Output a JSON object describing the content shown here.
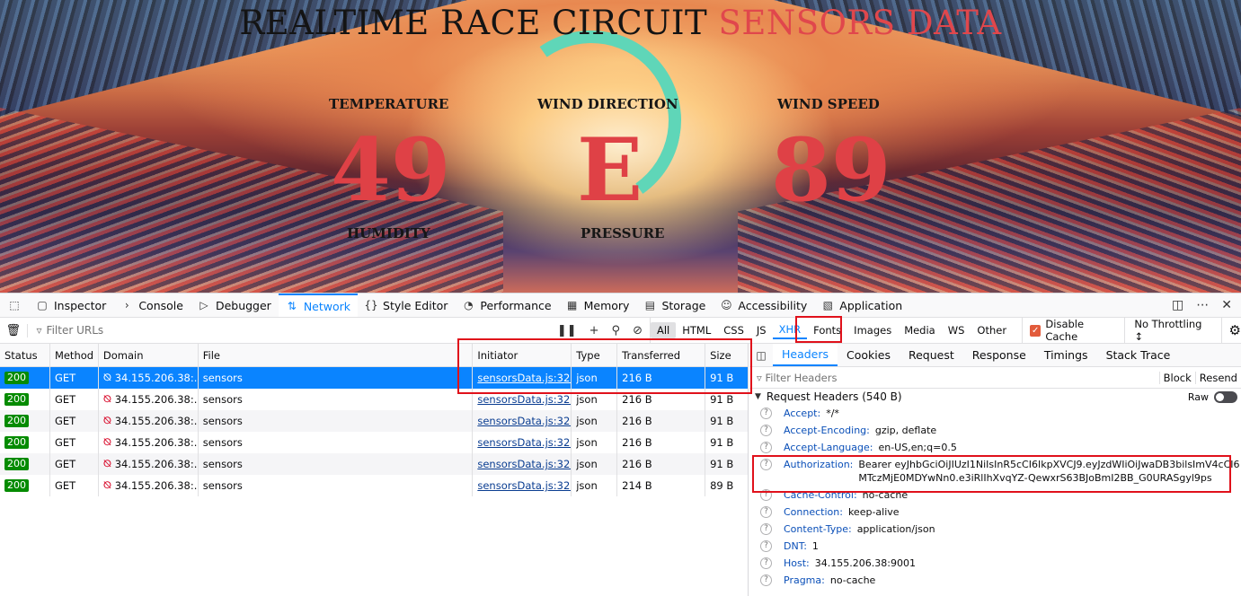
{
  "page": {
    "title_main": "REALTIME RACE CIRCUIT ",
    "title_accent": "SENSORS DATA",
    "metrics": [
      {
        "label": "TEMPERATURE",
        "value": "49"
      },
      {
        "label": "WIND DIRECTION",
        "value": "E"
      },
      {
        "label": "WIND SPEED",
        "value": "89"
      }
    ],
    "labels_row2": [
      "HUMIDITY",
      "PRESSURE"
    ]
  },
  "devtools": {
    "tabs": [
      "Inspector",
      "Console",
      "Debugger",
      "Network",
      "Style Editor",
      "Performance",
      "Memory",
      "Storage",
      "Accessibility",
      "Application"
    ],
    "active_tab": "Network",
    "filter_placeholder": "Filter URLs",
    "filter_types": [
      "All",
      "HTML",
      "CSS",
      "JS",
      "XHR",
      "Fonts",
      "Images",
      "Media",
      "WS",
      "Other"
    ],
    "disable_cache": "Disable Cache",
    "throttling": "No Throttling ↕"
  },
  "table": {
    "columns": [
      "Status",
      "Method",
      "Domain",
      "File",
      "Initiator",
      "Type",
      "Transferred",
      "Size"
    ],
    "rows": [
      {
        "status": "200",
        "method": "GET",
        "domain": "34.155.206.38:...",
        "file": "sensors",
        "initiator": "sensorsData.js:32...",
        "type": "json",
        "transferred": "216 B",
        "size": "91 B"
      },
      {
        "status": "200",
        "method": "GET",
        "domain": "34.155.206.38:...",
        "file": "sensors",
        "initiator": "sensorsData.js:32...",
        "type": "json",
        "transferred": "216 B",
        "size": "91 B"
      },
      {
        "status": "200",
        "method": "GET",
        "domain": "34.155.206.38:...",
        "file": "sensors",
        "initiator": "sensorsData.js:32...",
        "type": "json",
        "transferred": "216 B",
        "size": "91 B"
      },
      {
        "status": "200",
        "method": "GET",
        "domain": "34.155.206.38:...",
        "file": "sensors",
        "initiator": "sensorsData.js:32...",
        "type": "json",
        "transferred": "216 B",
        "size": "91 B"
      },
      {
        "status": "200",
        "method": "GET",
        "domain": "34.155.206.38:...",
        "file": "sensors",
        "initiator": "sensorsData.js:32...",
        "type": "json",
        "transferred": "216 B",
        "size": "91 B"
      },
      {
        "status": "200",
        "method": "GET",
        "domain": "34.155.206.38:...",
        "file": "sensors",
        "initiator": "sensorsData.js:32...",
        "type": "json",
        "transferred": "214 B",
        "size": "89 B"
      }
    ]
  },
  "side": {
    "tabs": [
      "Headers",
      "Cookies",
      "Request",
      "Response",
      "Timings",
      "Stack Trace"
    ],
    "filter_placeholder": "Filter Headers",
    "block": "Block",
    "resend": "Resend",
    "section": "Request Headers (540 B)",
    "raw": "Raw",
    "headers": [
      {
        "name": "Accept:",
        "value": "*/*"
      },
      {
        "name": "Accept-Encoding:",
        "value": "gzip, deflate"
      },
      {
        "name": "Accept-Language:",
        "value": "en-US,en;q=0.5"
      },
      {
        "name": "Authorization:",
        "value": "Bearer eyJhbGciOiJIUzI1NiIsInR5cCI6IkpXVCJ9.eyJzdWIiOiJwaDB3bilsImV4cCI6MTczMjE0MDYwNn0.e3iRlIhXvqYZ-QewxrS63BJoBmI2BB_G0URASgyl9ps"
      },
      {
        "name": "Cache-Control:",
        "value": "no-cache"
      },
      {
        "name": "Connection:",
        "value": "keep-alive"
      },
      {
        "name": "Content-Type:",
        "value": "application/json"
      },
      {
        "name": "DNT:",
        "value": "1"
      },
      {
        "name": "Host:",
        "value": "34.155.206.38:9001"
      },
      {
        "name": "Pragma:",
        "value": "no-cache"
      }
    ]
  }
}
